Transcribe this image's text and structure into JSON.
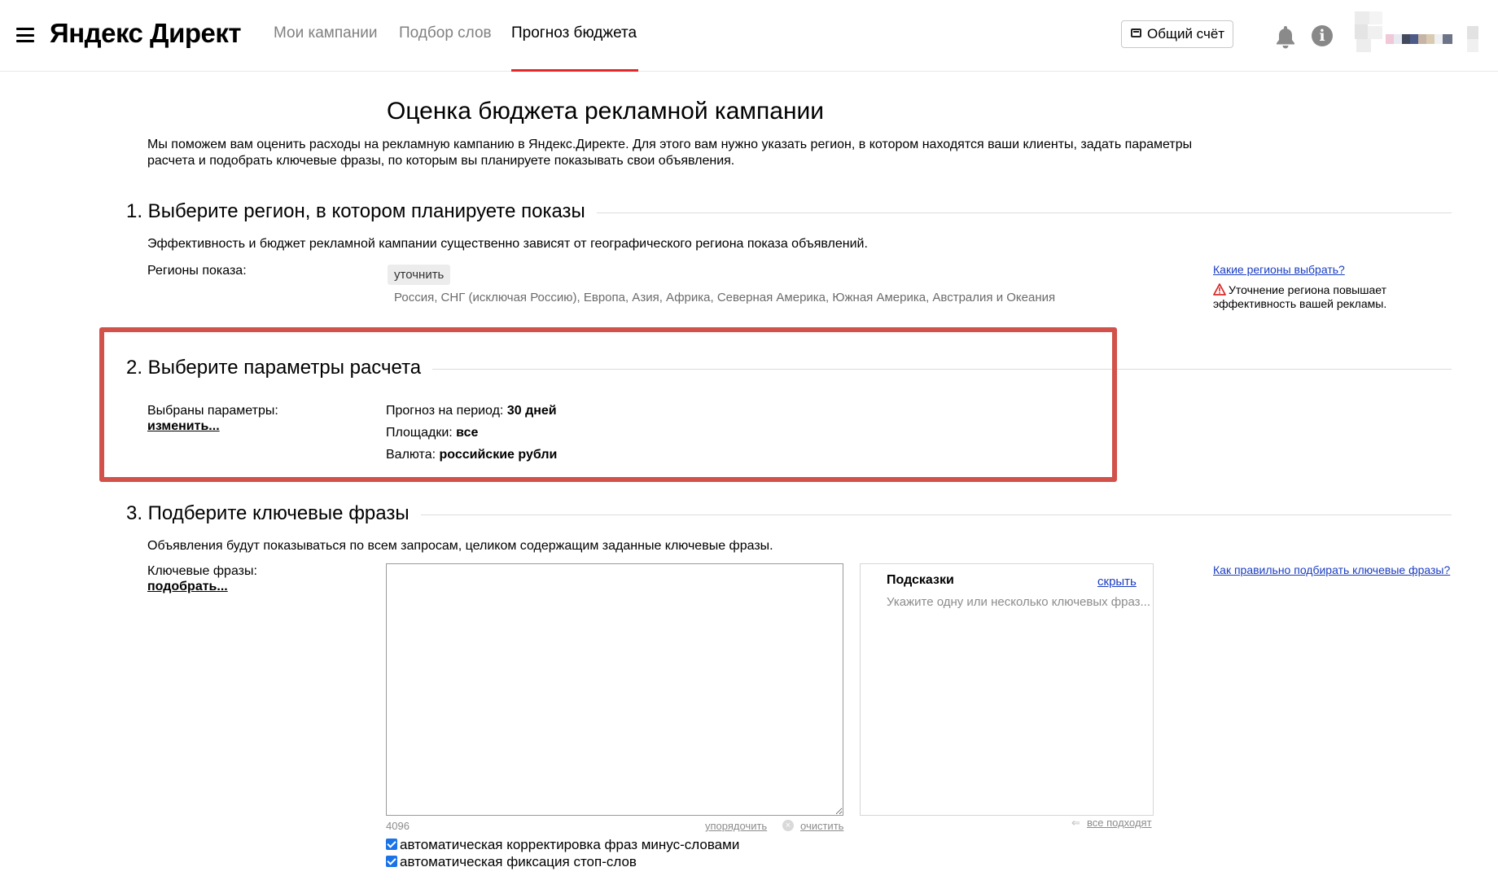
{
  "header": {
    "logo": "Яндекс Директ",
    "nav": [
      {
        "label": "Мои кампании"
      },
      {
        "label": "Подбор слов"
      },
      {
        "label": "Прогноз бюджета",
        "active": true
      }
    ],
    "account_button": "Общий счёт",
    "icons": [
      "menu-icon",
      "wallet-icon",
      "bell-icon",
      "info-icon"
    ],
    "accent_color": "#e0282b"
  },
  "main": {
    "title": "Оценка бюджета рекламной кампании",
    "intro": "Мы поможем вам оценить расходы на рекламную кампанию в Яндекс.Директе. Для этого вам нужно указать регион, в котором находятся ваши клиенты, задать параметры расчета и подобрать ключевые фразы, по которым вы планируете показывать свои объявления."
  },
  "section1": {
    "heading": "1. Выберите регион, в котором планируете показы",
    "description": "Эффективность и бюджет рекламной кампании существенно зависят от географического региона показа объявлений.",
    "regions_label": "Регионы показа:",
    "refine_button": "уточнить",
    "regions_value": "Россия, СНГ (исключая Россию), Европа, Азия, Африка, Северная Америка, Южная Америка, Австралия и Океания",
    "help_link": "Какие регионы выбрать?",
    "warning": "Уточнение региона повышает эффективность вашей рекламы."
  },
  "section2": {
    "heading": "2. Выберите параметры расчета",
    "selected_label": "Выбраны параметры:",
    "change_link": "изменить...",
    "period_label": "Прогноз на период:",
    "period_value": "30 дней",
    "platforms_label": "Площадки:",
    "platforms_value": "все",
    "currency_label": "Валюта:",
    "currency_value": "российские рубли",
    "highlight_color": "#d2514a"
  },
  "section3": {
    "heading": "3. Подберите ключевые фразы",
    "description": "Объявления будут показываться по всем запросам, целиком содержащим заданные ключевые фразы.",
    "keywords_label": "Ключевые фразы:",
    "pick_link": "подобрать...",
    "keywords_value": "",
    "char_limit": "4096",
    "sort_action": "упорядочить",
    "clear_action": "очистить",
    "hints_title": "Подсказки",
    "hints_hide": "скрыть",
    "hints_placeholder": "Укажите одну или несколько ключевых фраз...",
    "all_fit": "все подходят",
    "help_link": "Как правильно подбирать ключевые фразы?",
    "checkbox_minus": "автоматическая корректировка фраз минус-словами",
    "checkbox_minus_checked": true,
    "checkbox_stop": "автоматическая фиксация стоп-слов",
    "checkbox_stop_checked": true
  }
}
